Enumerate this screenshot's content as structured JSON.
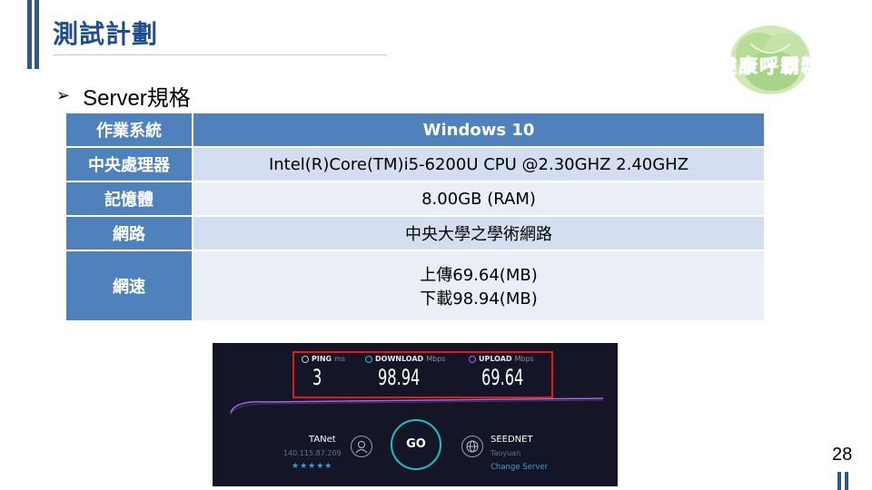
{
  "title": "測試計劃",
  "logo_text": "健康呼霸粒",
  "bullet": {
    "arrow": "➢",
    "text": "Server規格"
  },
  "spec_table": {
    "rows": [
      {
        "label": "作業系統",
        "value": "Windows 10"
      },
      {
        "label": "中央處理器",
        "value": "Intel(R)Core(TM)i5-6200U  CPU @2.30GHZ  2.40GHZ"
      },
      {
        "label": "記憶體",
        "value": "8.00GB (RAM)"
      },
      {
        "label": "網路",
        "value": "中央大學之學術網路"
      },
      {
        "label": "網速",
        "value_lines": [
          "上傳69.64(MB)",
          "下載98.94(MB)"
        ]
      }
    ]
  },
  "speedtest": {
    "ping": {
      "label": "PING",
      "unit": "ms",
      "value": "3"
    },
    "download": {
      "label": "DOWNLOAD",
      "unit": "Mbps",
      "value": "98.94"
    },
    "upload": {
      "label": "UPLOAD",
      "unit": "Mbps",
      "value": "69.64"
    },
    "go_label": "GO",
    "isp": {
      "name": "TANet",
      "ip": "140.115.87.209",
      "stars": "★★★★★"
    },
    "server": {
      "name": "SEEDNET",
      "location": "Taoyuan",
      "change_label": "Change Server"
    },
    "colors": {
      "ping": "#c9c9d6",
      "download": "#1ec0c8",
      "upload": "#a06ad8",
      "highlight": "#e3191c"
    }
  },
  "page_number": "28"
}
